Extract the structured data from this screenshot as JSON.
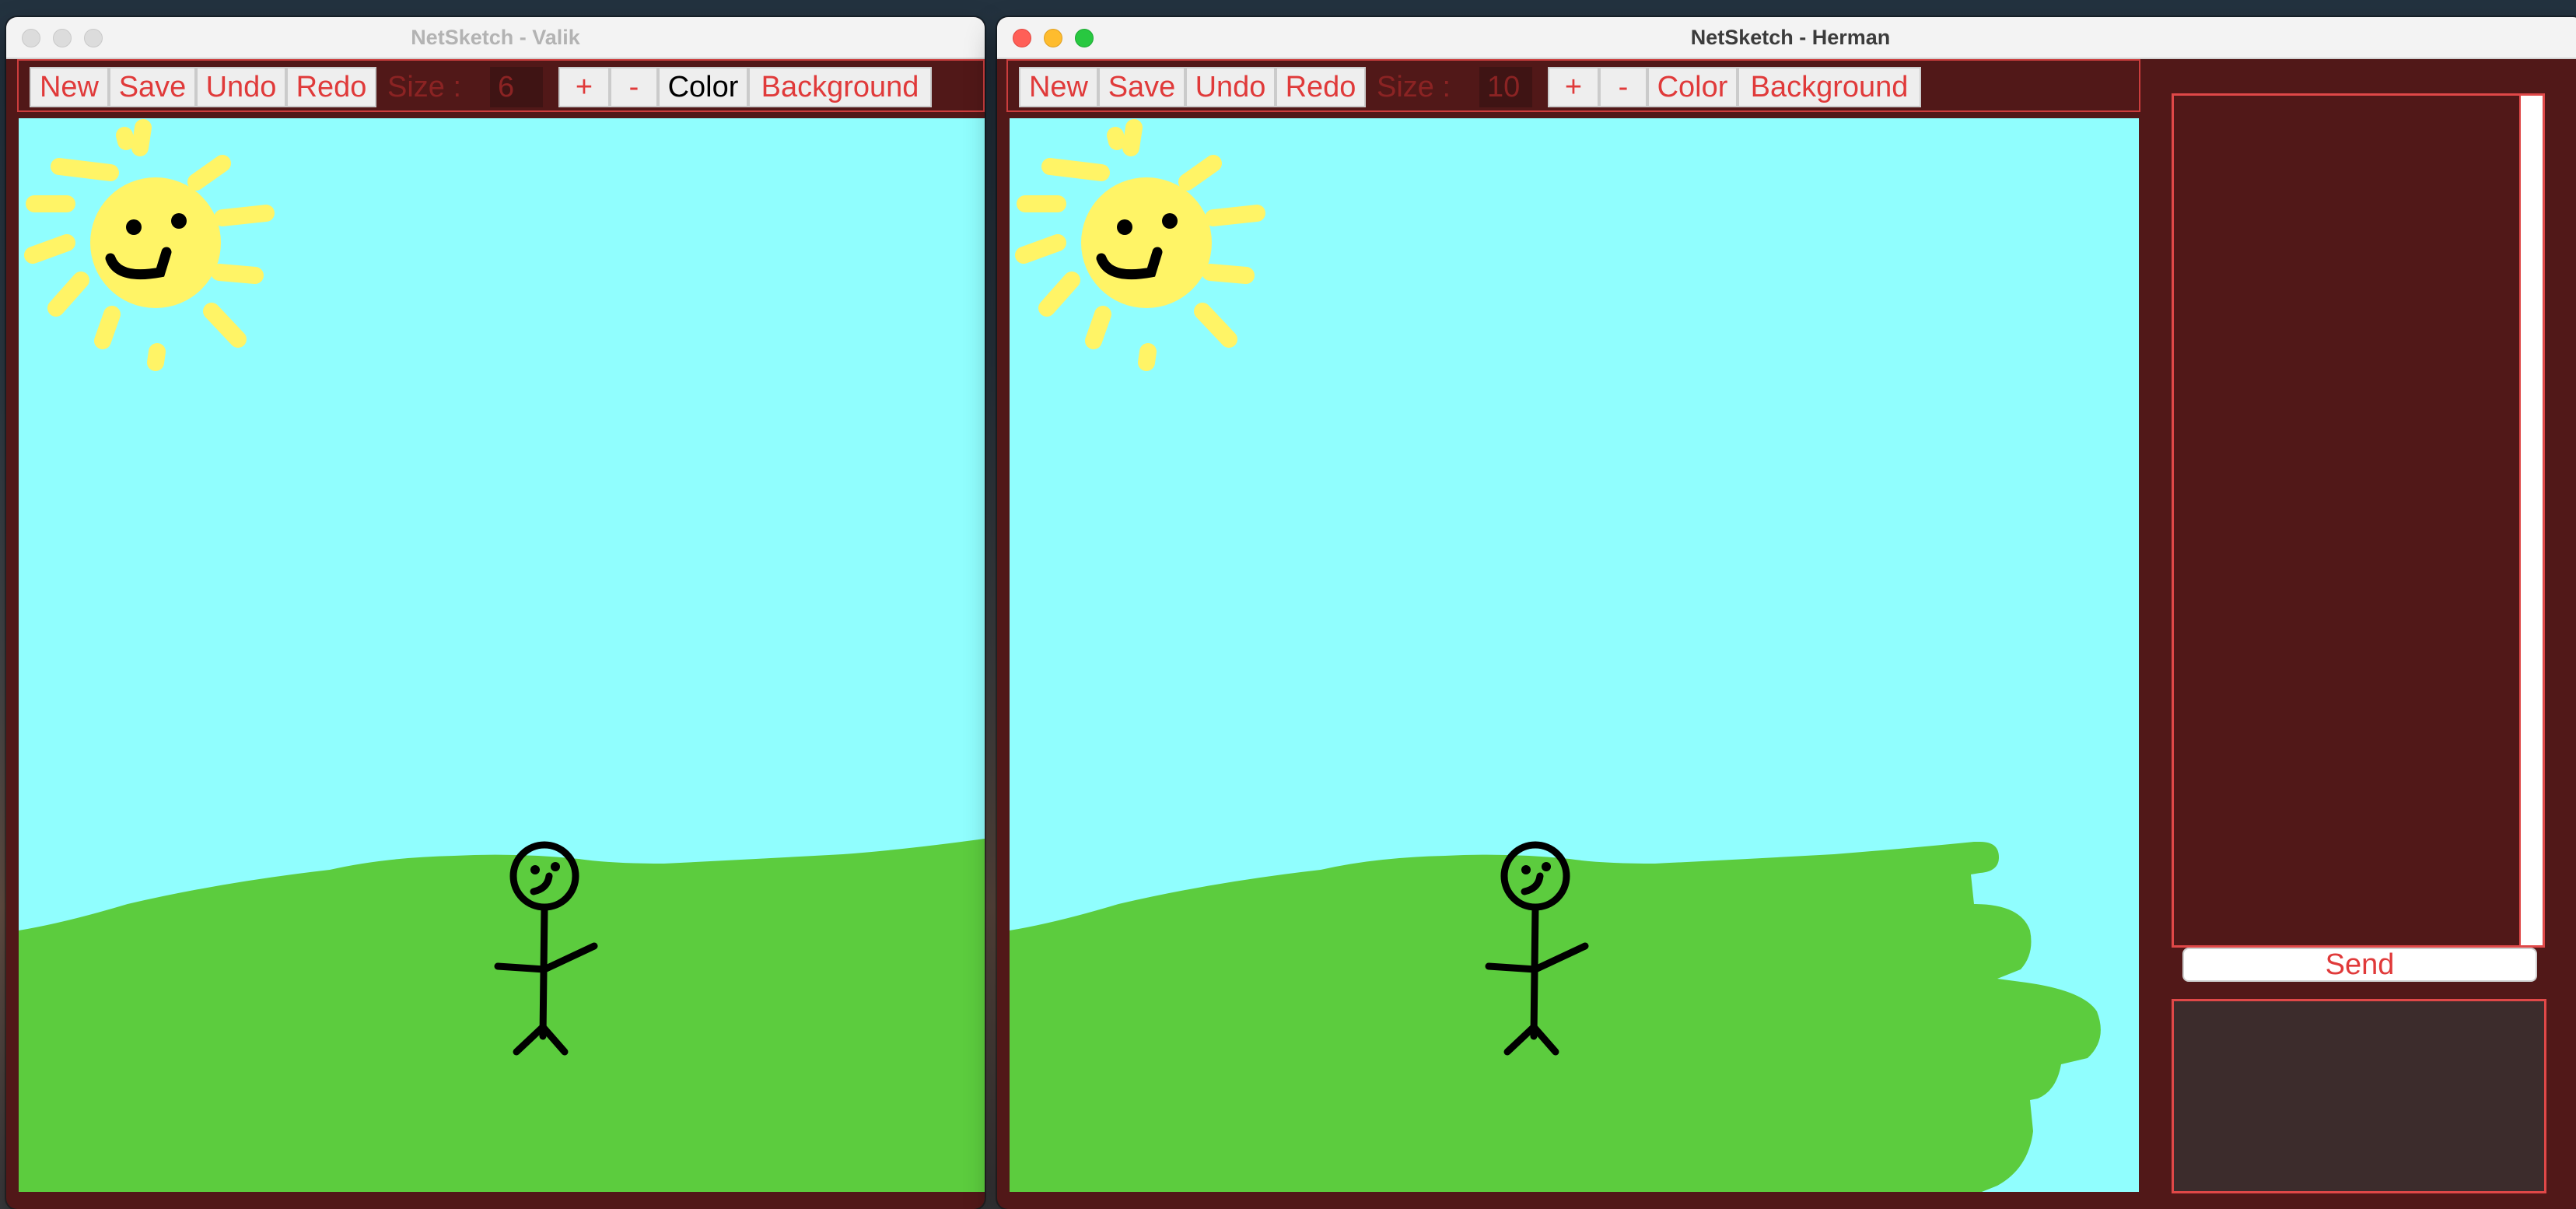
{
  "colors": {
    "window_bg": "#511818",
    "toolbar_border": "#cc3d3d",
    "button_text": "#e03a3a",
    "label_text": "#8b2323",
    "sky": "#90fefe",
    "grass": "#5ccc3e",
    "sun": "#fff466",
    "ink": "#000000"
  },
  "left_window": {
    "title": "NetSketch - Valik",
    "toolbar": {
      "new": "New",
      "save": "Save",
      "undo": "Undo",
      "redo": "Redo",
      "size_label": "Size :",
      "size_value": "6",
      "plus": "+",
      "minus": "-",
      "color": "Color",
      "background": "Background"
    }
  },
  "right_window": {
    "title": "NetSketch - Herman",
    "toolbar": {
      "new": "New",
      "save": "Save",
      "undo": "Undo",
      "redo": "Redo",
      "size_label": "Size :",
      "size_value": "10",
      "plus": "+",
      "minus": "-",
      "color": "Color",
      "background": "Background"
    },
    "chat": {
      "send": "Send"
    }
  }
}
